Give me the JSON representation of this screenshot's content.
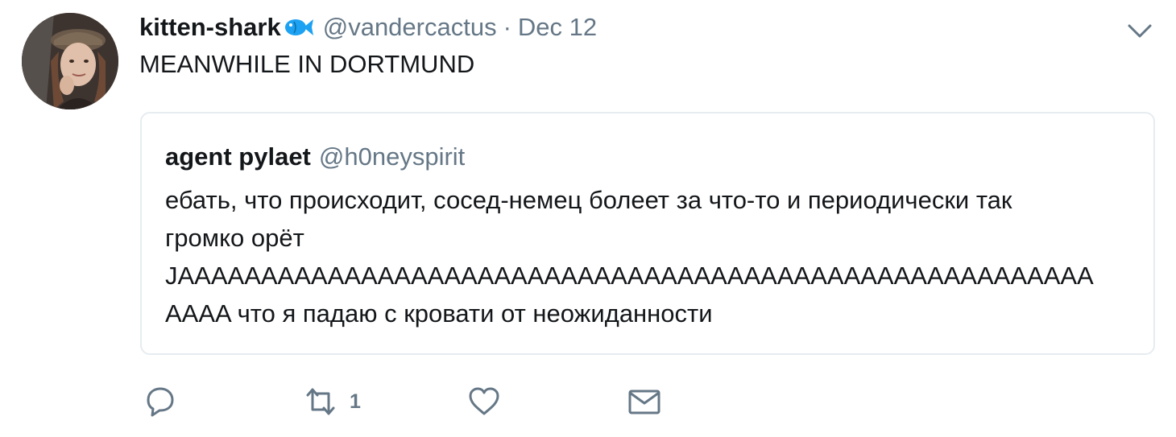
{
  "author": {
    "name": "kitten-shark",
    "emoji_icon": "fish-icon",
    "handle": "@vandercactus",
    "separator": "·",
    "date": "Dec 12"
  },
  "tweet": {
    "text": "MEANWHILE IN DORTMUND"
  },
  "quote": {
    "name": "agent pylaet",
    "handle": "@h0neyspirit",
    "lines": [
      "ебать, что происходит, сосед-немец болеет за что-то и периодически так",
      "громко орёт",
      "JAAAAAAAAAAAAAAAAAAAAAAAAAAAAAAAAAAAAAAAAAAAAAAAAAAAAAAA",
      "AAAA что я падаю с кровати от неожиданности"
    ]
  },
  "actions": {
    "reply_icon": "reply-icon",
    "retweet_icon": "retweet-icon",
    "retweet_count": "1",
    "like_icon": "heart-icon",
    "dm_icon": "envelope-icon"
  },
  "colors": {
    "text": "#14171a",
    "secondary": "#657786",
    "border": "#e6ecf0",
    "fish": "#1da1f2"
  }
}
